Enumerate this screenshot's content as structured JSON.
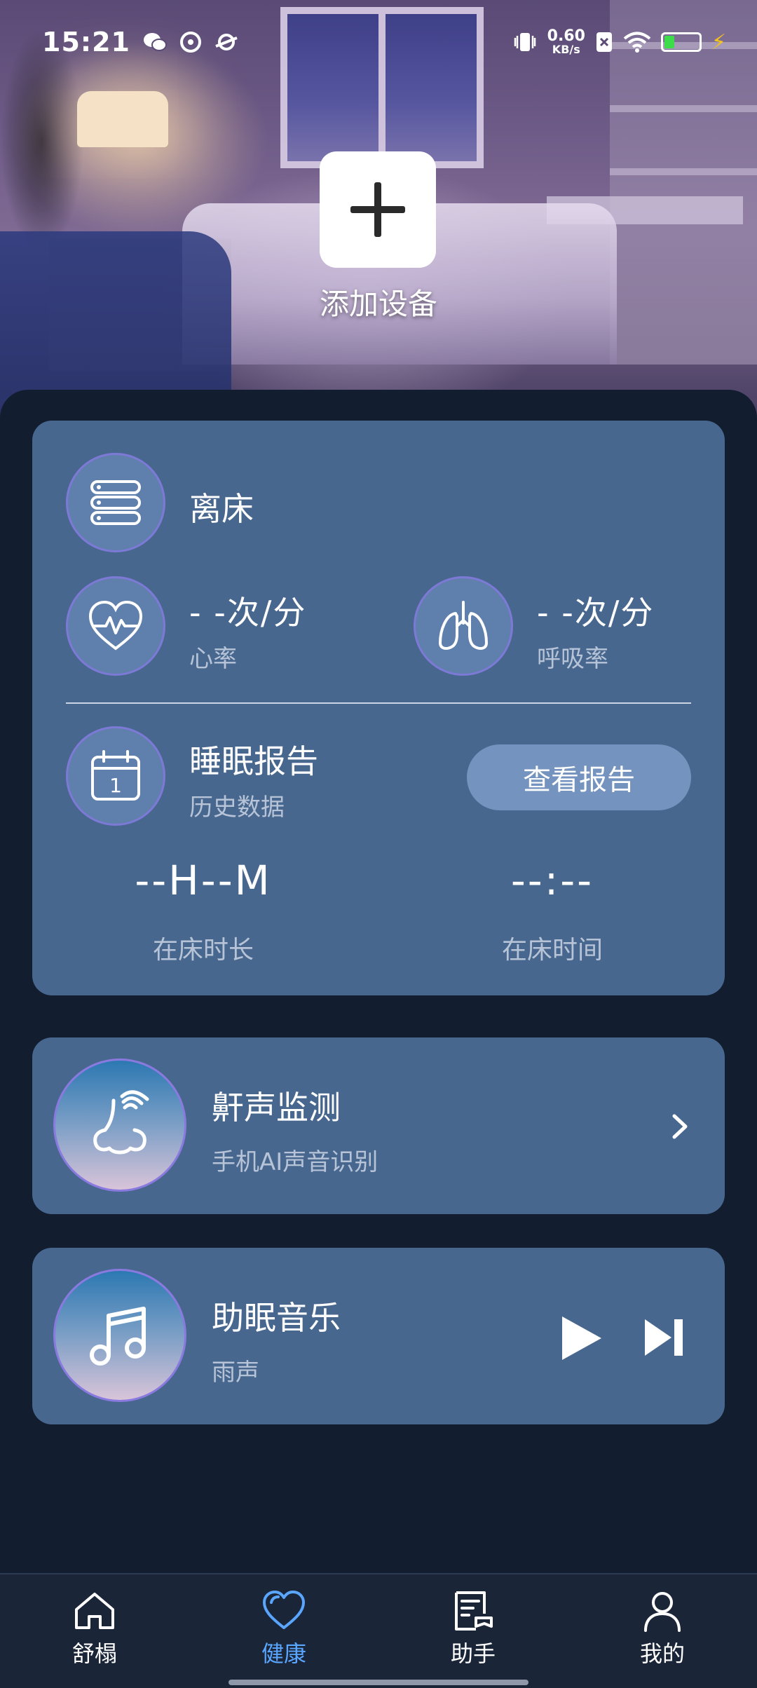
{
  "status_bar": {
    "time": "15:21",
    "net_speed_value": "0.60",
    "net_speed_unit": "KB/s",
    "battery_level": 0.3
  },
  "hero": {
    "add_device_label": "添加设备"
  },
  "main_card": {
    "bed_status": "离床",
    "heart_rate_value": "- -次/分",
    "heart_rate_label": "心率",
    "breath_rate_value": "- -次/分",
    "breath_rate_label": "呼吸率",
    "report_title": "睡眠报告",
    "report_subtitle": "历史数据",
    "view_report_button": "查看报告",
    "calendar_day": "1",
    "duration_value": "--H--M",
    "duration_label": "在床时长",
    "time_value": "--:--",
    "time_label": "在床时间"
  },
  "snore_card": {
    "title": "鼾声监测",
    "subtitle": "手机AI声音识别"
  },
  "music_card": {
    "title": "助眠音乐",
    "subtitle": "雨声"
  },
  "bottom_nav": {
    "items": [
      {
        "label": "舒榻",
        "icon": "home-icon",
        "active": false
      },
      {
        "label": "健康",
        "icon": "heart-icon",
        "active": true
      },
      {
        "label": "助手",
        "icon": "assistant-icon",
        "active": false
      },
      {
        "label": "我的",
        "icon": "profile-icon",
        "active": false
      }
    ]
  },
  "colors": {
    "background": "#121d2f",
    "card": "#48678e",
    "active_tab": "#5aa6ff",
    "report_button": "#7493be"
  }
}
